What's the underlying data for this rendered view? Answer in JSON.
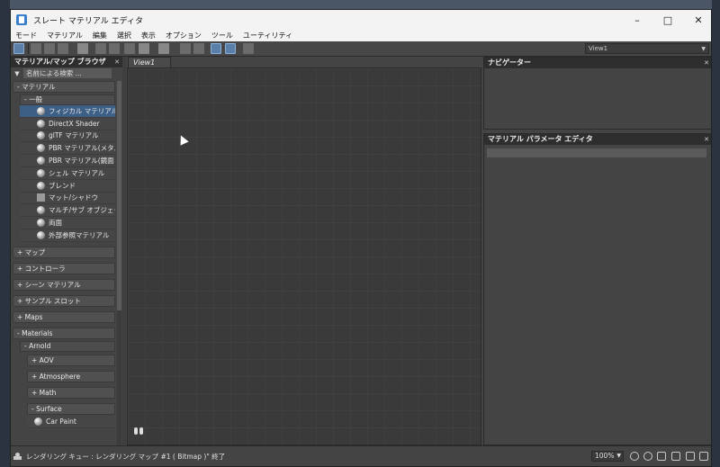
{
  "window": {
    "title": "スレート マテリアル エディタ"
  },
  "menu": [
    "モード",
    "マテリアル",
    "編集",
    "選択",
    "表示",
    "オプション",
    "ツール",
    "ユーティリティ"
  ],
  "toolbar": {
    "view_dropdown": "View1"
  },
  "browser": {
    "title": "マテリアル/マップ ブラウザ",
    "search_placeholder": "名前による検索 ...",
    "materials_group": "- マテリアル",
    "general_group": "- 一般",
    "items": [
      {
        "label": "フィジカル マテリアル",
        "icon": "sphere-icon"
      },
      {
        "label": "DirectX Shader",
        "icon": "sphere-icon"
      },
      {
        "label": "glTF マテリアル",
        "icon": "sphere-icon"
      },
      {
        "label": "PBR マテリアル(メタル ...",
        "icon": "sphere-icon"
      },
      {
        "label": "PBR マテリアル(鏡面 ...",
        "icon": "sphere-icon"
      },
      {
        "label": "シェル マテリアル",
        "icon": "sphere-icon"
      },
      {
        "label": "ブレンド",
        "icon": "sphere-icon"
      },
      {
        "label": "マット/シャドウ",
        "icon": "square-icon"
      },
      {
        "label": "マルチ/サブ オブジェクト",
        "icon": "sphere-icon"
      },
      {
        "label": "両面",
        "icon": "sphere-icon"
      },
      {
        "label": "外部参照マテリアル",
        "icon": "sphere-icon"
      }
    ],
    "groups": [
      "+ マップ",
      "+ コントローラ",
      "+ シーン マテリアル",
      "+ サンプル スロット",
      "+ Maps",
      "- Materials"
    ],
    "arnold": {
      "label": "- Arnold",
      "subs": [
        "+ AOV",
        "+ Atmosphere",
        "+ Math",
        "- Surface"
      ],
      "surface_item": "Car Paint"
    }
  },
  "view": {
    "tab": "View1"
  },
  "navigator": {
    "title": "ナビゲーター"
  },
  "param_editor": {
    "title": "マテリアル パラメータ エディタ"
  },
  "status": {
    "text": "レンダリング キュー : レンダリング マップ #1 ( Bitmap )\" 終了",
    "zoom": "100%"
  }
}
